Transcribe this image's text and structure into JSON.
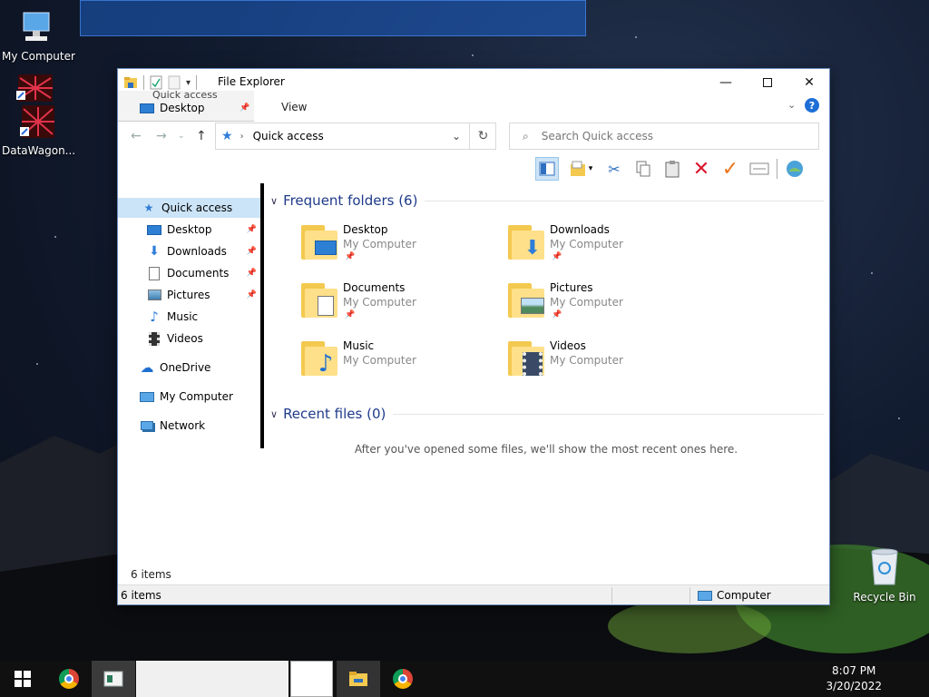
{
  "desktop": {
    "icons": {
      "my_computer": "My Computer",
      "datawagon": "DataWagon...",
      "recycle_bin": "Recycle Bin"
    }
  },
  "window": {
    "title": "File Explorer",
    "ribbon_tabs": {
      "view": "View"
    },
    "overlay": {
      "header": "Quick access",
      "item": "Desktop"
    },
    "address": {
      "location": "Quick access"
    },
    "search": {
      "placeholder": "Search Quick access"
    },
    "nav": [
      {
        "label": "Quick access",
        "icon": "star-icon"
      },
      {
        "label": "Desktop",
        "icon": "desktop-icon",
        "pinned": true
      },
      {
        "label": "Downloads",
        "icon": "download-icon",
        "pinned": true
      },
      {
        "label": "Documents",
        "icon": "document-icon",
        "pinned": true
      },
      {
        "label": "Pictures",
        "icon": "pictures-icon",
        "pinned": true
      },
      {
        "label": "Music",
        "icon": "music-icon"
      },
      {
        "label": "Videos",
        "icon": "videos-icon"
      },
      {
        "label": "OneDrive",
        "icon": "cloud-icon"
      },
      {
        "label": "My Computer",
        "icon": "computer-icon"
      },
      {
        "label": "Network",
        "icon": "network-icon"
      }
    ],
    "frequent": {
      "header": "Frequent folders (6)",
      "folders": [
        {
          "name": "Desktop",
          "location": "My Computer"
        },
        {
          "name": "Downloads",
          "location": "My Computer"
        },
        {
          "name": "Documents",
          "location": "My Computer"
        },
        {
          "name": "Pictures",
          "location": "My Computer"
        },
        {
          "name": "Music",
          "location": "My Computer"
        },
        {
          "name": "Videos",
          "location": "My Computer"
        }
      ]
    },
    "recent": {
      "header": "Recent files (0)",
      "empty_message": "After you've opened some files, we'll show the most recent ones here."
    },
    "status": {
      "items_inline": "6 items",
      "items_bar": "6 items",
      "computer": "Computer"
    }
  },
  "taskbar": {
    "time": "8:07 PM",
    "date": "3/20/2022"
  },
  "colors": {
    "accent": "#1e3a8a",
    "selection": "#cce4f7",
    "folder": "#ffe08a"
  }
}
